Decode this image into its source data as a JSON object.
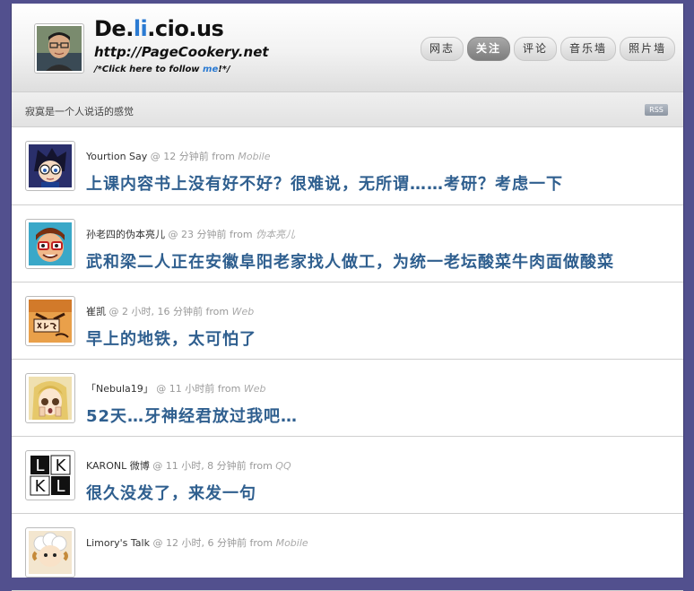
{
  "header": {
    "title_a": "De.",
    "title_b": "li",
    "title_c": ".cio.us",
    "url": "http://PageCookery.net",
    "follow_prefix": "/*Click here to follow ",
    "follow_me": "me",
    "follow_suffix": "!*/"
  },
  "nav": {
    "tabs": [
      {
        "label": "网志",
        "active": false
      },
      {
        "label": "关注",
        "active": true
      },
      {
        "label": "评论",
        "active": false
      },
      {
        "label": "音乐墙",
        "active": false
      },
      {
        "label": "照片墙",
        "active": false
      }
    ]
  },
  "tagline": "寂寞是一个人说话的感觉",
  "rss_label": "RSS",
  "posts": [
    {
      "author": "Yourtion Say",
      "time": "@ 12 分钟前",
      "from": "from",
      "source": "Mobile",
      "text": "上课内容书上没有好不好？很难说，无所谓……考研？考虑一下"
    },
    {
      "author": "孙老四的伪本亮儿",
      "time": "@ 23 分钟前",
      "from": "from",
      "source": "伪本亮儿",
      "text": "武和梁二人正在安徽阜阳老家找人做工，为统一老坛酸菜牛肉面做酸菜"
    },
    {
      "author": "崔凯",
      "time": "@ 2 小时, 16 分钟前",
      "from": "from",
      "source": "Web",
      "text": "早上的地铁，太可怕了"
    },
    {
      "author": "「Nebula19」",
      "time": "@ 11 小时前",
      "from": "from",
      "source": "Web",
      "text": "52天…牙神经君放过我吧…"
    },
    {
      "author": "KARONL 微博",
      "time": "@ 11 小时, 8 分钟前",
      "from": "from",
      "source": "QQ",
      "text": "很久没发了，来发一句"
    },
    {
      "author": "Limory's Talk",
      "time": "@ 12 小时, 6 分钟前",
      "from": "from",
      "source": "Mobile",
      "text": ""
    }
  ]
}
